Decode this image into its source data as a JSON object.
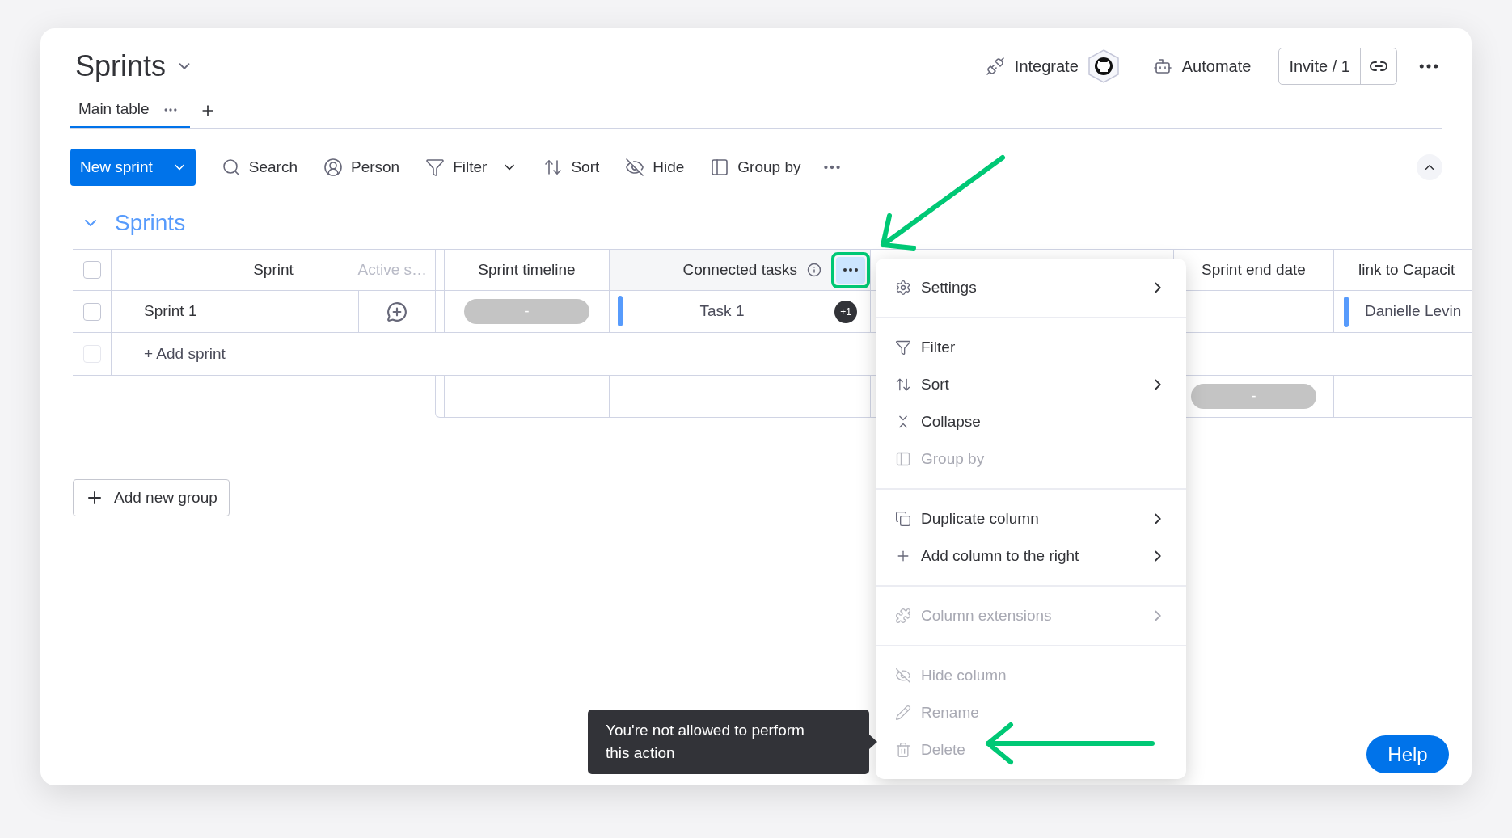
{
  "board": {
    "title": "Sprints"
  },
  "header_actions": [
    {
      "kind": "integrate",
      "label": "Integrate"
    },
    {
      "kind": "automate",
      "label": "Automate"
    }
  ],
  "invite": {
    "label": "Invite / 1"
  },
  "views": [
    {
      "label": "Main table",
      "selected": true
    }
  ],
  "toolbar": {
    "primary": "New sprint",
    "items": [
      {
        "kind": "search",
        "label": "Search",
        "dropdown": false
      },
      {
        "kind": "person",
        "label": "Person",
        "dropdown": false
      },
      {
        "kind": "filter",
        "label": "Filter",
        "dropdown": true
      },
      {
        "kind": "sort",
        "label": "Sort",
        "dropdown": false
      },
      {
        "kind": "hide",
        "label": "Hide",
        "dropdown": false
      },
      {
        "kind": "group",
        "label": "Group by",
        "dropdown": false
      }
    ]
  },
  "group": {
    "title": "Sprints",
    "expanded": true
  },
  "table": {
    "columns": {
      "sprint": "Sprint",
      "ghost": "Active s…",
      "timeline": "Sprint timeline",
      "connected": "Connected tasks",
      "end_date": "Sprint end date",
      "capacity": "link to Capacit"
    },
    "rows": [
      {
        "checked": false,
        "sprint": "Sprint 1",
        "timeline": "-",
        "connected": "Task 1",
        "connected_more": "+1",
        "capacity": "Danielle Levin"
      }
    ],
    "select_all": {
      "checked": false
    },
    "add_row_check": {
      "checked": false
    },
    "add_row": "+ Add sprint",
    "summary_end_date": "-"
  },
  "add_group": "Add new group",
  "column_menu": {
    "sections": [
      [
        {
          "kind": "settings",
          "label": "Settings",
          "disabled": false,
          "submenu": true
        }
      ],
      [
        {
          "kind": "filter",
          "label": "Filter",
          "disabled": false,
          "submenu": false
        },
        {
          "kind": "sort",
          "label": "Sort",
          "disabled": false,
          "submenu": true
        },
        {
          "kind": "collapse",
          "label": "Collapse",
          "disabled": false,
          "submenu": false
        },
        {
          "kind": "group",
          "label": "Group by",
          "disabled": true,
          "submenu": false
        }
      ],
      [
        {
          "kind": "duplicate",
          "label": "Duplicate column",
          "disabled": false,
          "submenu": true
        },
        {
          "kind": "add",
          "label": "Add column to the right",
          "disabled": false,
          "submenu": true
        }
      ],
      [
        {
          "kind": "extensions",
          "label": "Column extensions",
          "disabled": true,
          "submenu": true
        }
      ],
      [
        {
          "kind": "hide",
          "label": "Hide column",
          "disabled": true,
          "submenu": false
        },
        {
          "kind": "rename",
          "label": "Rename",
          "disabled": true,
          "submenu": false
        },
        {
          "kind": "delete",
          "label": "Delete",
          "disabled": true,
          "submenu": false
        }
      ]
    ]
  },
  "tooltip": "You're not allowed to perform this action",
  "help": "Help"
}
